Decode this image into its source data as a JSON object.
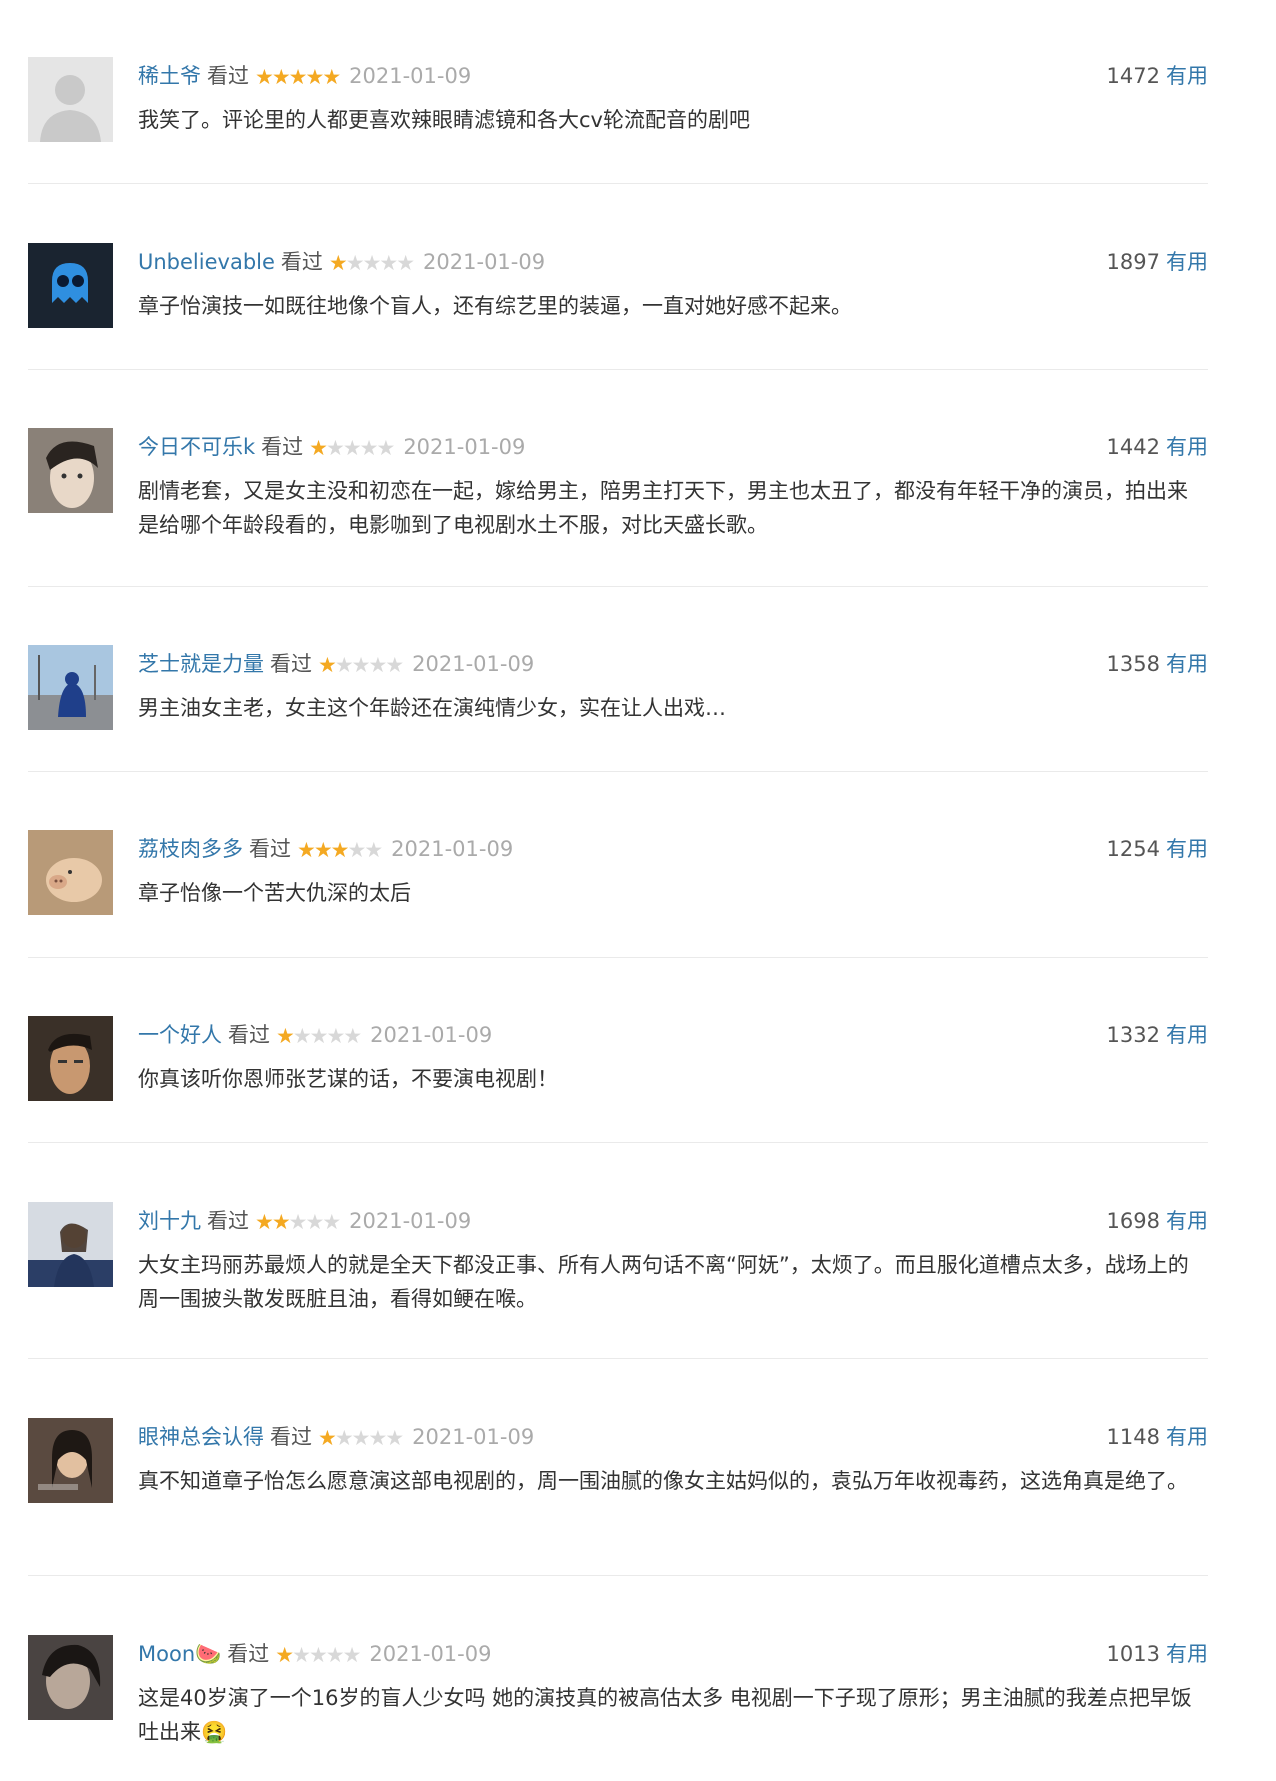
{
  "reviews": [
    {
      "name": "稀土爷",
      "status": "看过",
      "rating": 5,
      "date": "2021-01-09",
      "count": "1472",
      "useful_label": "有用",
      "text": "我笑了。评论里的人都更喜欢辣眼睛滤镜和各大cv轮流配音的剧吧",
      "avatar": "default-avatar"
    },
    {
      "name": "Unbelievable",
      "status": "看过",
      "rating": 1,
      "date": "2021-01-09",
      "count": "1897",
      "useful_label": "有用",
      "text": "章子怡演技一如既往地像个盲人，还有综艺里的装逼，一直对她好感不起来。",
      "avatar": "blue-ghost"
    },
    {
      "name": "今日不可乐k",
      "status": "看过",
      "rating": 1,
      "date": "2021-01-09",
      "count": "1442",
      "useful_label": "有用",
      "text": "剧情老套，又是女主没和初恋在一起，嫁给男主，陪男主打天下，男主也太丑了，都没有年轻干净的演员，拍出来是给哪个年龄段看的，电影咖到了电视剧水土不服，对比天盛长歌。",
      "avatar": "portrait"
    },
    {
      "name": "芝士就是力量",
      "status": "看过",
      "rating": 1,
      "date": "2021-01-09",
      "count": "1358",
      "useful_label": "有用",
      "text": "男主油女主老，女主这个年龄还在演纯情少女，实在让人出戏…",
      "avatar": "street-photo"
    },
    {
      "name": "荔枝肉多多",
      "status": "看过",
      "rating": 3,
      "date": "2021-01-09",
      "count": "1254",
      "useful_label": "有用",
      "text": "章子怡像一个苦大仇深的太后",
      "avatar": "pig-photo"
    },
    {
      "name": "一个好人",
      "status": "看过",
      "rating": 1,
      "date": "2021-01-09",
      "count": "1332",
      "useful_label": "有用",
      "text": "你真该听你恩师张艺谋的话，不要演电视剧！",
      "avatar": "face-photo"
    },
    {
      "name": "刘十九",
      "status": "看过",
      "rating": 2,
      "date": "2021-01-09",
      "count": "1698",
      "useful_label": "有用",
      "text": "大女主玛丽苏最烦人的就是全天下都没正事、所有人两句话不离“阿妩”，太烦了。而且服化道槽点太多，战场上的周一围披头散发既脏且油，看得如鲠在喉。",
      "avatar": "woman-photo"
    },
    {
      "name": "眼神总会认得",
      "status": "看过",
      "rating": 1,
      "date": "2021-01-09",
      "count": "1148",
      "useful_label": "有用",
      "text": "真不知道章子怡怎么愿意演这部电视剧的，周一围油腻的像女主姑妈似的，袁弘万年收视毒药，这选角真是绝了。",
      "avatar": "actress-photo"
    },
    {
      "name": "Moon🍉",
      "status": "看过",
      "rating": 1,
      "date": "2021-01-09",
      "count": "1013",
      "useful_label": "有用",
      "text": "这是40岁演了一个16岁的盲人少女吗 她的演技真的被高估太多 电视剧一下子现了原形；男主油腻的我差点把早饭吐出来🤮",
      "avatar": "dark-photo"
    }
  ],
  "colors": {
    "link": "#3377aa",
    "star": "#f4a922",
    "star_off": "#d8d8d8",
    "date": "#aaaaaa",
    "text": "#333333"
  }
}
